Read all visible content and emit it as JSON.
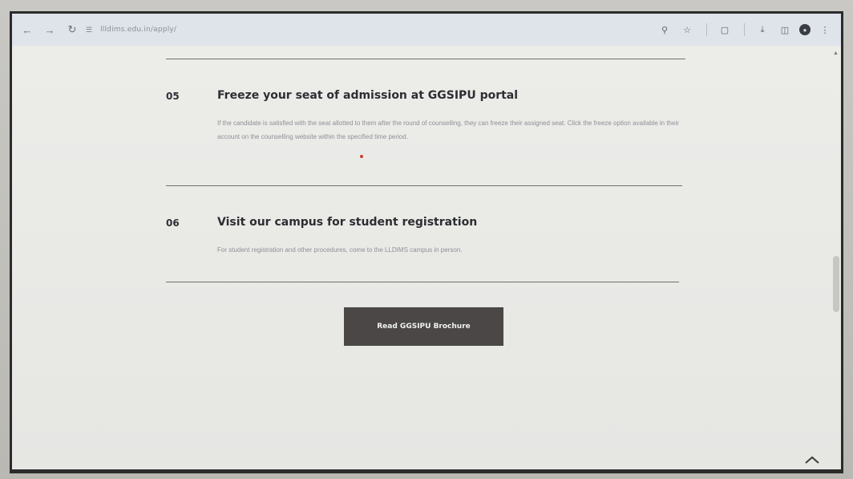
{
  "browser": {
    "url": "llldims.edu.in/apply/",
    "icons": {
      "back": "arrow-left-icon",
      "forward": "arrow-right-icon",
      "reload": "reload-icon",
      "site_info": "site-info-icon",
      "zoom": "zoom-icon",
      "bookmark": "star-icon",
      "extensions": "puzzle-icon",
      "download": "download-icon",
      "sidebar": "sidebar-icon",
      "profile": "profile-icon",
      "menu": "more-vertical-icon"
    }
  },
  "steps": [
    {
      "number": "05",
      "title": "Freeze your seat of admission at GGSIPU portal",
      "description": "If the candidate is satisfied with the seat allotted to them after the round of counselling, they can freeze their assigned seat. Click the freeze option available in their account on the counselling website within the specified time period."
    },
    {
      "number": "06",
      "title": "Visit our campus for student registration",
      "description": "For student registration and other procedures, come to the LLDIMS campus in person."
    }
  ],
  "cta": {
    "label": "Read GGSIPU Brochure"
  },
  "colors": {
    "button_bg": "#4a4746",
    "accent_dot": "#c9402e"
  }
}
